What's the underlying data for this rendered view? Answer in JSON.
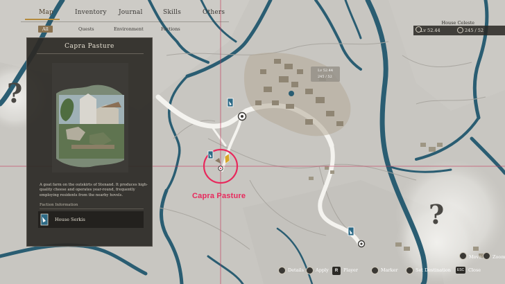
{
  "nav": {
    "tabs": [
      "Map",
      "Inventory",
      "Journal",
      "Skills",
      "Others"
    ],
    "active_tab": "Map",
    "subtabs": [
      "All",
      "Quests",
      "Environment",
      "Factions"
    ],
    "active_subtab": "All"
  },
  "hud": {
    "house": "House Celeste",
    "level": "Lv 52.44",
    "reputation": "245 / 52"
  },
  "panel": {
    "title": "Capra Pasture",
    "description": "A goat farm on the outskirts of Stenand. It produces high-quality cheese and operates year-round, frequently employing residents from the nearby hovels.",
    "faction_header": "Faction Information",
    "faction_name": "House Serkis"
  },
  "marker_label": "Capra Pasture",
  "mini_tag": {
    "line1": "Lv 52.44",
    "line2": "245 / 52"
  },
  "controls": {
    "details": "Details",
    "apply": "Apply",
    "r_key": "R",
    "player": "Player",
    "marker": "Marker",
    "set_destination": "Set Destination",
    "move": "Move",
    "zoom": "Zoom",
    "esc_key": "ESC",
    "close": "Close"
  },
  "colors": {
    "accent": "#e8285c",
    "panel_bg": "#2c2a26",
    "water": "#2a5d72",
    "road": "#f4f3ef",
    "tab_underline": "#b48a3c"
  }
}
